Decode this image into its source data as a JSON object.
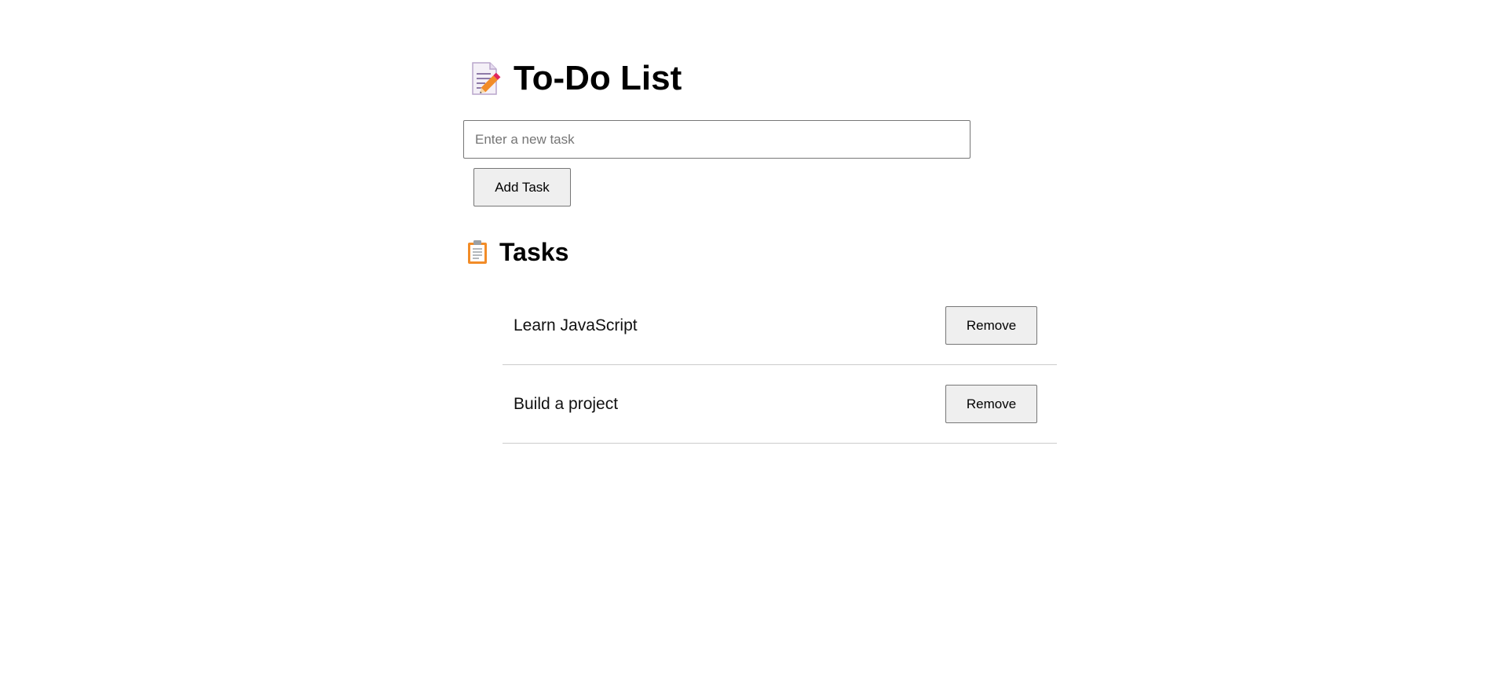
{
  "header": {
    "title": "To-Do List",
    "icon": "memo-pencil-icon"
  },
  "form": {
    "input_placeholder": "Enter a new task",
    "input_value": "",
    "add_button_label": "Add Task"
  },
  "tasks_section": {
    "title": "Tasks",
    "icon": "clipboard-icon",
    "items": [
      {
        "text": "Learn JavaScript",
        "remove_label": "Remove"
      },
      {
        "text": "Build a project",
        "remove_label": "Remove"
      }
    ]
  },
  "colors": {
    "button_bg": "#efefef",
    "border": "#767676",
    "divider": "#cccccc",
    "pencil": "#f28c28",
    "eraser": "#e0245e"
  }
}
